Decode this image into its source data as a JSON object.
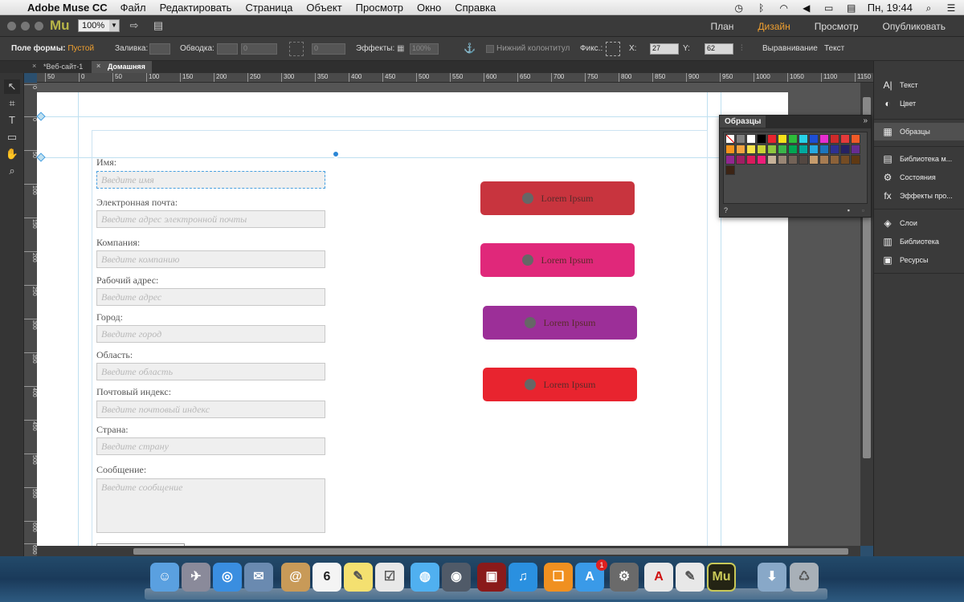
{
  "menubar": {
    "app_name": "Adobe Muse CC",
    "items": [
      "Файл",
      "Редактировать",
      "Страница",
      "Объект",
      "Просмотр",
      "Окно",
      "Справка"
    ],
    "clock": "Пн, 19:44"
  },
  "titlebar": {
    "logo": "Mu",
    "zoom": "100%",
    "modes": [
      "План",
      "Дизайн",
      "Просмотр",
      "Опубликовать"
    ],
    "active_mode": "Дизайн"
  },
  "options": {
    "form_field_label": "Поле формы:",
    "form_field_value": "Пустой",
    "fill_label": "Заливка:",
    "stroke_label": "Обводка:",
    "stroke_value": "0",
    "stroke_value2": "0",
    "effects_label": "Эффекты:",
    "effects_value": "100%",
    "footer_label": "Нижний колонтитул",
    "fixed_label": "Фикс.:",
    "x_label": "X:",
    "x_value": "27",
    "y_label": "Y:",
    "y_value": "62",
    "align_label": "Выравнивание",
    "text_label": "Текст"
  },
  "doc_tabs": [
    {
      "label": "*Веб-сайт-1"
    },
    {
      "label": "Домашняя"
    }
  ],
  "ruler_h": [
    "50",
    "0",
    "50",
    "100",
    "150",
    "200",
    "250",
    "300",
    "350",
    "400",
    "450",
    "500",
    "550",
    "600",
    "650",
    "700",
    "750",
    "800",
    "850",
    "900",
    "950",
    "1000",
    "1050",
    "1100",
    "1150"
  ],
  "ruler_v": [
    "0",
    "0",
    "50",
    "100",
    "150",
    "200",
    "250",
    "300",
    "350",
    "400",
    "450",
    "500",
    "550",
    "600",
    "650"
  ],
  "form": {
    "fields": [
      {
        "label": "Имя:",
        "placeholder": "Введите имя"
      },
      {
        "label": "Электронная почта:",
        "placeholder": "Введите адрес электронной почты"
      },
      {
        "label": "Компания:",
        "placeholder": "Введите компанию"
      },
      {
        "label": "Рабочий адрес:",
        "placeholder": "Введите адрес"
      },
      {
        "label": "Город:",
        "placeholder": "Введите город"
      },
      {
        "label": "Область:",
        "placeholder": "Введите область"
      },
      {
        "label": "Почтовый индекс:",
        "placeholder": "Введите почтовый индекс"
      },
      {
        "label": "Страна:",
        "placeholder": "Введите страну"
      },
      {
        "label": "Сообщение:",
        "placeholder": "Введите сообщение"
      }
    ]
  },
  "buttons": [
    {
      "label": "Lorem Ipsum",
      "color": "#c8343e"
    },
    {
      "label": "Lorem Ipsum",
      "color": "#e0287a"
    },
    {
      "label": "Lorem Ipsum",
      "color": "#9c2f98"
    },
    {
      "label": "Lorem Ipsum",
      "color": "#e8242f"
    }
  ],
  "swatches_panel": {
    "title": "Образцы",
    "colors": [
      "#ffffff",
      "#808080",
      "#ffffff",
      "#000000",
      "#e8242f",
      "#f7e11a",
      "#2ebd3a",
      "#28d2e8",
      "#1e4fd6",
      "#e62ed0",
      "#cf2a2a",
      "#e53a3a",
      "#f05a28",
      "#f7941d",
      "#f2a341",
      "#f7e24b",
      "#c8d336",
      "#8dc63f",
      "#39b54a",
      "#00a651",
      "#00a99d",
      "#27aae1",
      "#1c75bc",
      "#2e3192",
      "#262262",
      "#662d91",
      "#92278f",
      "#9e1f63",
      "#d91c5c",
      "#ed1e79",
      "#c7b299",
      "#998675",
      "#736357",
      "#534741",
      "#c69c6d",
      "#a67c52",
      "#8c6239",
      "#754c24",
      "#603913",
      "#3c2415"
    ]
  },
  "right_panel": {
    "items": [
      {
        "icon": "A|",
        "label": "Текст"
      },
      {
        "icon": "◐",
        "label": "Цвет"
      },
      {
        "icon": "▦",
        "label": "Образцы"
      },
      {
        "icon": "▤",
        "label": "Библиотека м..."
      },
      {
        "icon": "⚙",
        "label": "Состояния"
      },
      {
        "icon": "fx",
        "label": "Эффекты про..."
      },
      {
        "icon": "◈",
        "label": "Слои"
      },
      {
        "icon": "▥",
        "label": "Библиотека"
      },
      {
        "icon": "▣",
        "label": "Ресурсы"
      }
    ],
    "active": "Образцы"
  },
  "dock": {
    "calendar_day": "6",
    "appstore_badge": "1"
  }
}
